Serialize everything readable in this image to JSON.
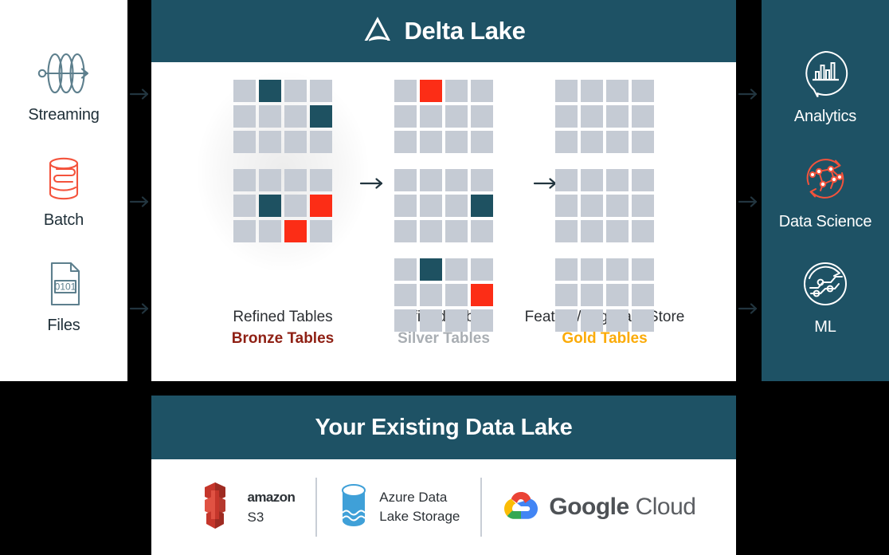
{
  "colors": {
    "panel_teal": "#1e5265",
    "cell_gray": "#c5cbd4",
    "cell_teal": "#1e5161",
    "cell_red": "#fc2d16",
    "bronze_text": "#8f2014",
    "silver_text": "#a9aeb3",
    "gold_text": "#fbab08",
    "arrow_navy": "#22353f",
    "source_icon_blue": "#5d7f8d",
    "accent_red": "#f4533c",
    "background": "#000000"
  },
  "sources": {
    "items": [
      {
        "label": "Streaming",
        "icon": "streaming-waves-icon"
      },
      {
        "label": "Batch",
        "icon": "database-batch-icon"
      },
      {
        "label": "Files",
        "icon": "file-binary-icon"
      }
    ]
  },
  "delta": {
    "title": "Delta Lake",
    "logo_icon": "delta-lake-triangle-icon",
    "flow_arrow_icon": "right-arrow-icon",
    "stages": [
      {
        "id": "bronze",
        "title": "Refined Tables",
        "subtitle": "Bronze Tables",
        "subtitle_color": "#8f2014",
        "has_glow": true,
        "blocks": [
          [
            [
              "gray",
              "teal",
              "gray",
              "gray"
            ],
            [
              "gray",
              "gray",
              "gray",
              "teal"
            ],
            [
              "gray",
              "gray",
              "gray",
              "gray"
            ]
          ],
          [
            [
              "gray",
              "gray",
              "gray",
              "gray"
            ],
            [
              "gray",
              "teal",
              "gray",
              "red"
            ],
            [
              "gray",
              "gray",
              "red",
              "gray"
            ]
          ]
        ]
      },
      {
        "id": "silver",
        "title": "Refined Tables",
        "subtitle": "Silver Tables",
        "subtitle_color": "#a9aeb3",
        "has_glow": false,
        "blocks": [
          [
            [
              "gray",
              "red",
              "gray",
              "gray"
            ],
            [
              "gray",
              "gray",
              "gray",
              "gray"
            ],
            [
              "gray",
              "gray",
              "gray",
              "gray"
            ]
          ],
          [
            [
              "gray",
              "gray",
              "gray",
              "gray"
            ],
            [
              "gray",
              "gray",
              "gray",
              "teal"
            ],
            [
              "gray",
              "gray",
              "gray",
              "gray"
            ]
          ],
          [
            [
              "gray",
              "teal",
              "gray",
              "gray"
            ],
            [
              "gray",
              "gray",
              "gray",
              "red"
            ],
            [
              "gray",
              "gray",
              "gray",
              "gray"
            ]
          ]
        ]
      },
      {
        "id": "gold",
        "title": "Feature/Agg Data Store",
        "subtitle": "Gold Tables",
        "subtitle_color": "#fbab08",
        "has_glow": false,
        "blocks": [
          [
            [
              "gray",
              "gray",
              "gray",
              "gray"
            ],
            [
              "gray",
              "gray",
              "gray",
              "gray"
            ],
            [
              "gray",
              "gray",
              "gray",
              "gray"
            ]
          ],
          [
            [
              "gray",
              "gray",
              "gray",
              "gray"
            ],
            [
              "gray",
              "gray",
              "gray",
              "gray"
            ],
            [
              "gray",
              "gray",
              "gray",
              "gray"
            ]
          ],
          [
            [
              "gray",
              "gray",
              "gray",
              "gray"
            ],
            [
              "gray",
              "gray",
              "gray",
              "gray"
            ],
            [
              "gray",
              "gray",
              "gray",
              "gray"
            ]
          ]
        ]
      }
    ]
  },
  "consumers": {
    "items": [
      {
        "label": "Analytics",
        "icon": "analytics-chart-bubble-icon"
      },
      {
        "label": "Data Science",
        "icon": "data-science-network-icon"
      },
      {
        "label": "ML",
        "icon": "machine-learning-circuit-icon"
      }
    ]
  },
  "lake": {
    "title": "Your Existing Data Lake",
    "providers": [
      {
        "id": "aws-s3",
        "icon": "aws-s3-bucket-icon",
        "line1": "amazon",
        "line2": "S3"
      },
      {
        "id": "azure-adls",
        "icon": "azure-data-lake-cylinder-icon",
        "line1": "Azure Data",
        "line2": "Lake Storage"
      },
      {
        "id": "google-cloud",
        "icon": "google-cloud-icon",
        "line1": "Google",
        "line2": "Cloud"
      }
    ]
  }
}
